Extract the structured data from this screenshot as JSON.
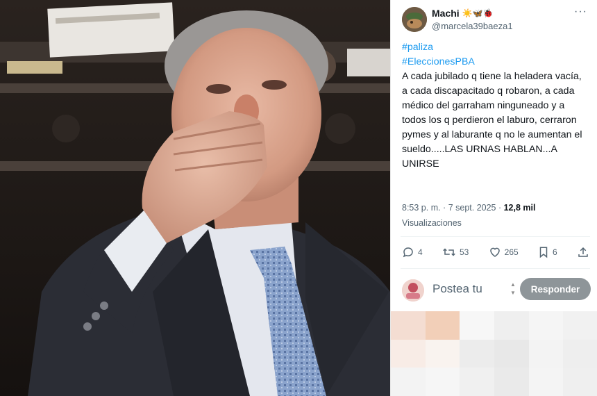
{
  "photo": {
    "description_icon": "photo-image"
  },
  "tweet": {
    "author": {
      "name": "Machi",
      "emojis": "☀️🦋🐞",
      "handle": "@marcela39baeza1"
    },
    "more_label": "···",
    "hashtags": [
      "#paliza",
      "#EleccionesPBA"
    ],
    "text": "A cada jubilado q tiene la heladera vacía, a cada discapacitado q robaron, a cada médico del garraham ninguneado y a todos los q perdieron el laburo, cerraron pymes y al laburante q no le aumentan el sueldo.....LAS URNAS HABLAN...A UNIRSE",
    "timestamp": "8:53 p. m. · 7 sept. 2025 · ",
    "views_count": "12,8 mil",
    "views_label": "Visualizaciones",
    "actions": {
      "replies": "4",
      "retweets": "53",
      "likes": "265",
      "bookmarks": "6"
    },
    "reply_box": {
      "placeholder": "Postea tu",
      "button_label": "Responder"
    }
  },
  "colors": {
    "link": "#1d9bf0",
    "text": "#0f1419",
    "muted": "#536471",
    "button_disabled": "#8e9599"
  }
}
